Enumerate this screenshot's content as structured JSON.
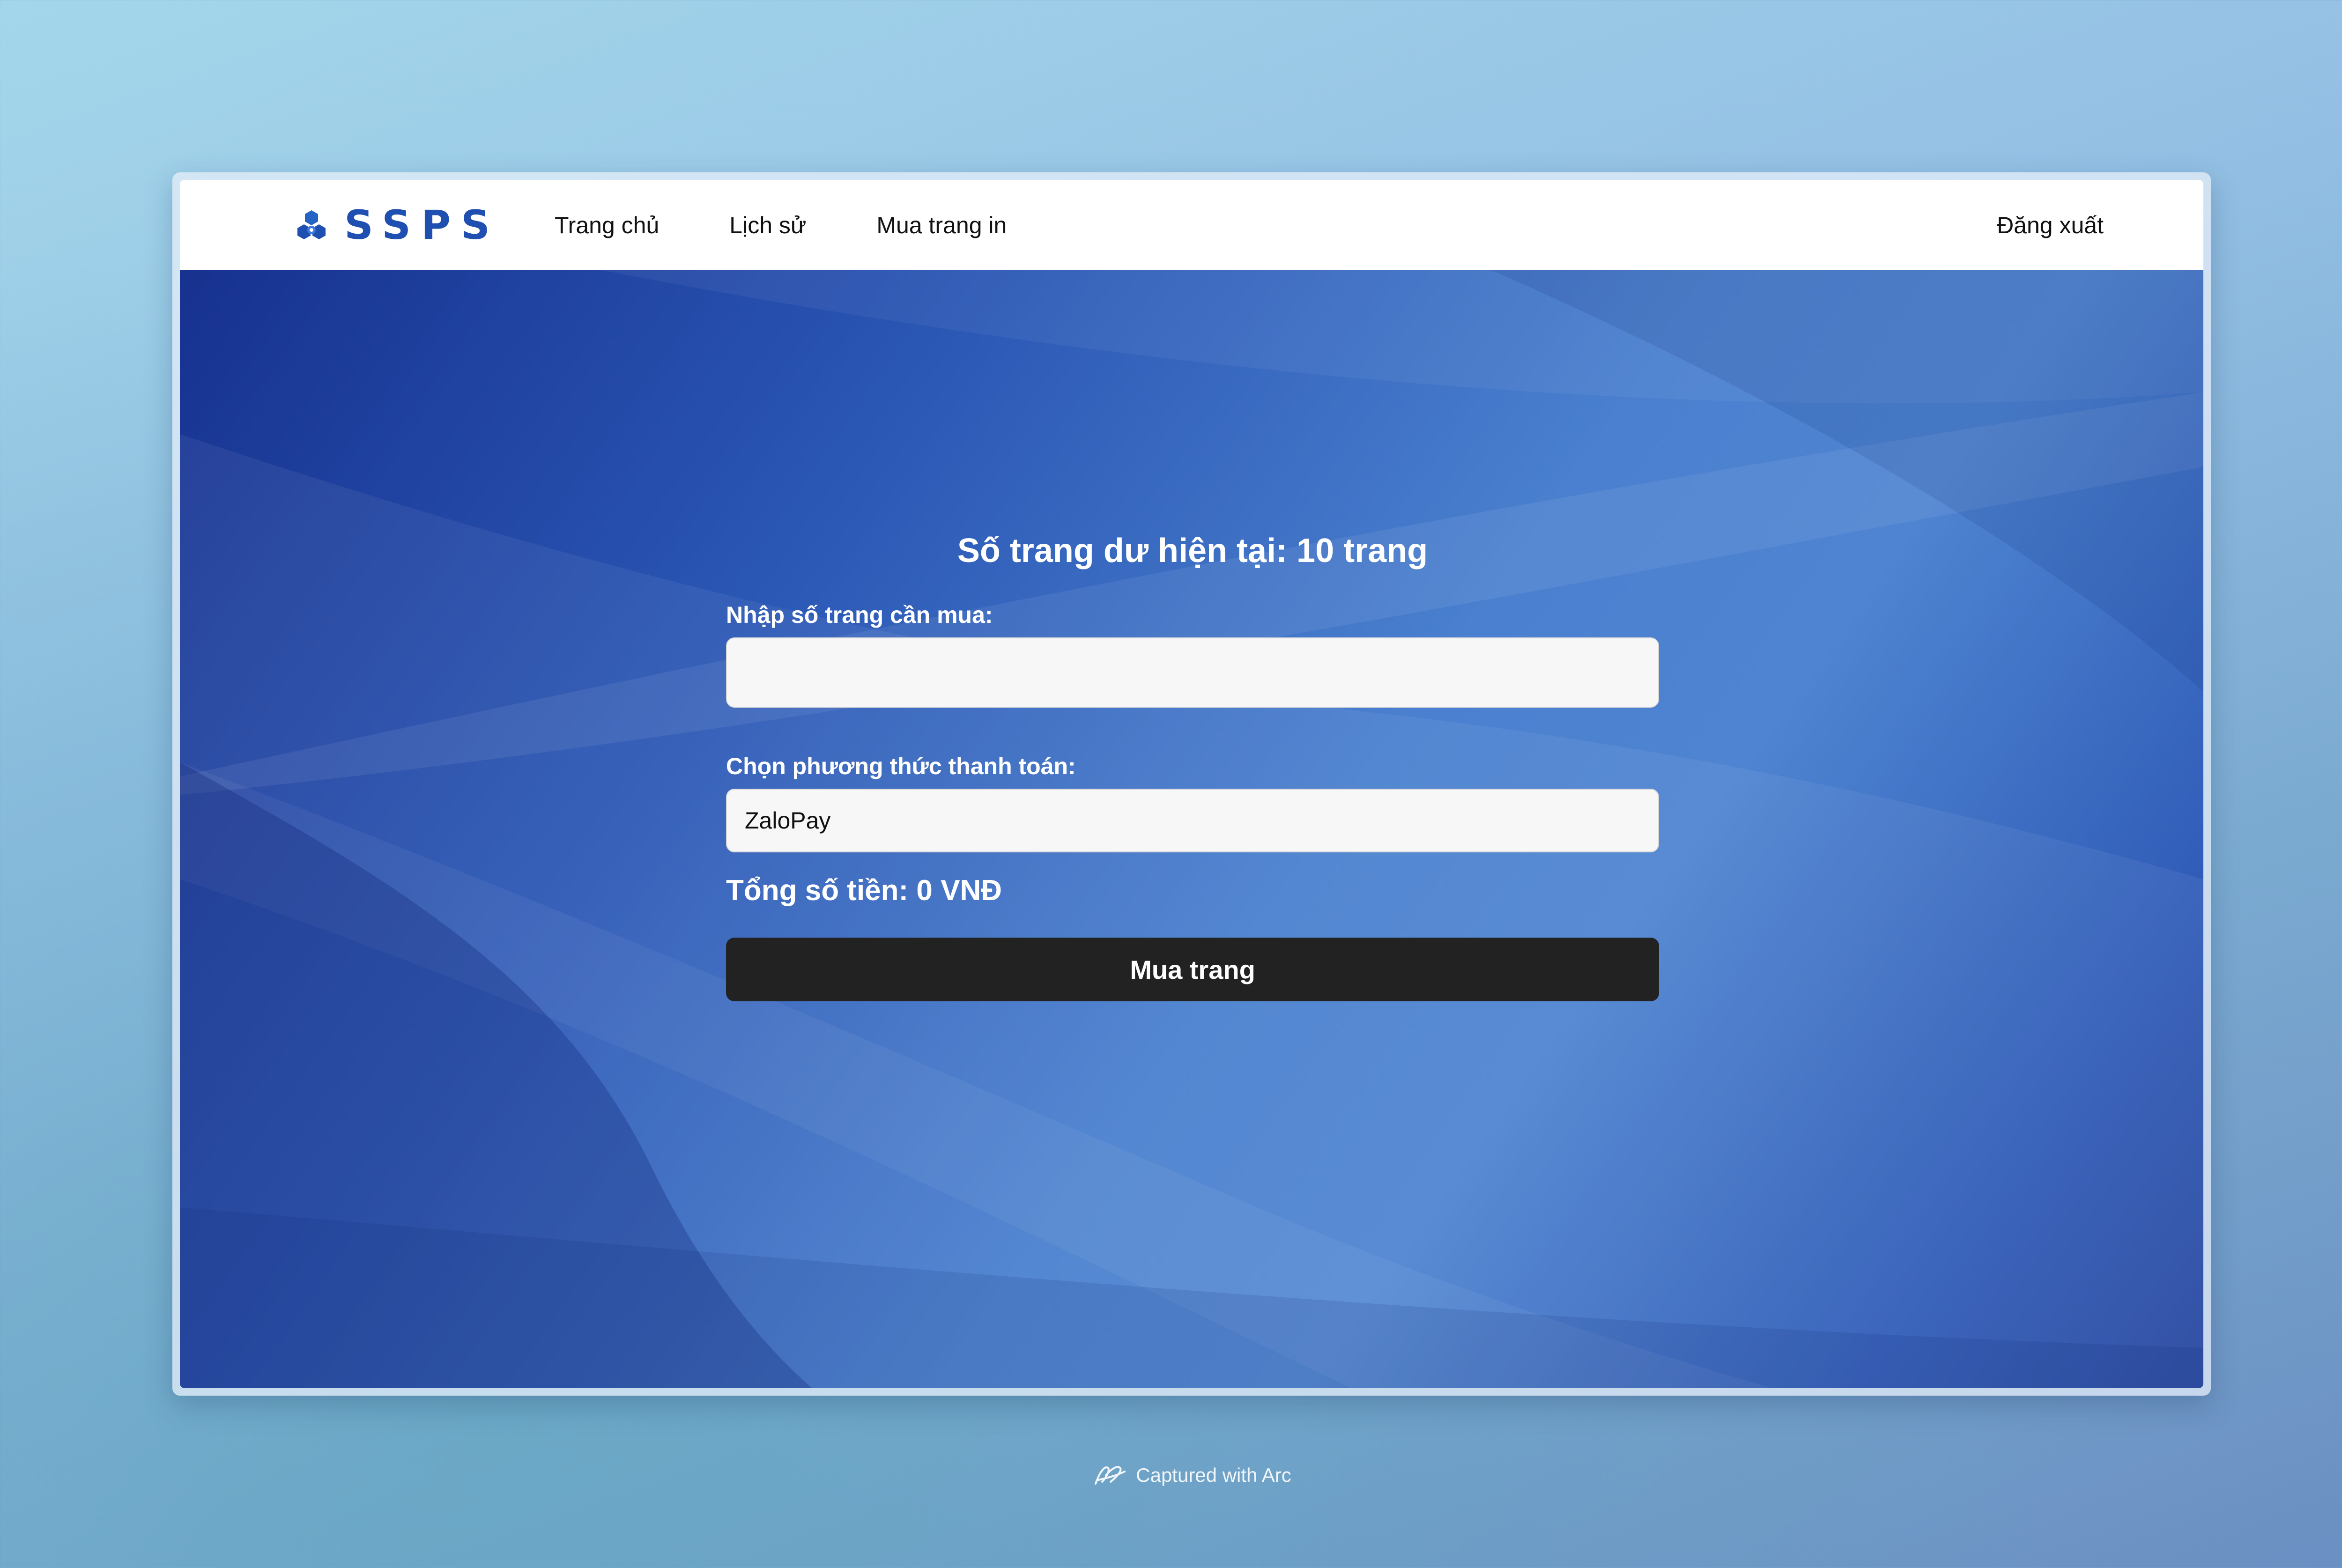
{
  "header": {
    "logo_text": "SSPS",
    "nav": [
      {
        "label": "Trang chủ"
      },
      {
        "label": "Lịch sử"
      },
      {
        "label": "Mua trang in"
      }
    ],
    "logout_label": "Đăng xuất"
  },
  "purchase_form": {
    "title": "Số trang dư hiện tại: 10 trang",
    "pages_label": "Nhập số trang cần mua:",
    "pages_value": "",
    "payment_label": "Chọn phương thức thanh toán:",
    "payment_selected": "ZaloPay",
    "total_text": "Tổng số tiền: 0 VNĐ",
    "submit_label": "Mua trang"
  },
  "footer": {
    "capture_text": "Captured with Arc"
  },
  "colors": {
    "brand": "#1f4fb0",
    "button": "#222222",
    "hero_dark": "#17318f",
    "hero_light": "#4e84d1"
  },
  "icons": {
    "logo": "hcmut-logo-icon",
    "footer": "arc-icon"
  }
}
